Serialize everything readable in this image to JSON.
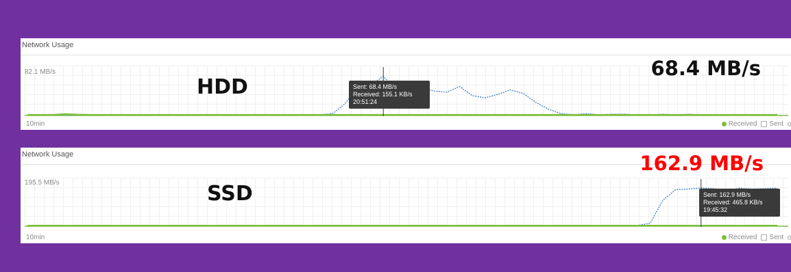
{
  "colors": {
    "background": "#7030a0",
    "received_line": "#3f7fc0",
    "baseline": "#7cbf3a",
    "highlight": "#ff0000",
    "tooltip_bg": "#3a3a3a"
  },
  "panels": [
    {
      "id": "hdd",
      "title": "Network Usage",
      "max_label": "82.1 MB/s",
      "range_label": "10min",
      "big_label": "HDD",
      "speed_label": "68.4 MB/s",
      "speed_color": "#111111",
      "legend": {
        "received": "Received",
        "sent": "Sent",
        "zero": "0"
      },
      "tooltip": {
        "sent": "Sent: 68.4 MB/s",
        "received": "Received: 155.1 KB/s",
        "time": "20:51:24"
      }
    },
    {
      "id": "ssd",
      "title": "Network Usage",
      "max_label": "195.5 MB/s",
      "range_label": "10min",
      "big_label": "SSD",
      "speed_label": "162.9 MB/s",
      "speed_color": "#ff0000",
      "legend": {
        "received": "Received",
        "sent": "Sent",
        "zero": "0"
      },
      "tooltip": {
        "sent": "Sent: 162.9 MB/s",
        "received": "Received: 465.8 KB/s",
        "time": "19:45:32"
      }
    }
  ],
  "chart_data": [
    {
      "type": "line",
      "title": "Network Usage",
      "ylim": [
        0,
        82.1
      ],
      "xlabel": "10min",
      "hover_index": 28,
      "series": [
        {
          "name": "Sent",
          "values": [
            0,
            0,
            0,
            0,
            0,
            0,
            0,
            0,
            0,
            0,
            0,
            0,
            0,
            0,
            0,
            0,
            0,
            0,
            0,
            0,
            0,
            0,
            0,
            0,
            2,
            20,
            48,
            52,
            68,
            45,
            36,
            48,
            42,
            40,
            50,
            34,
            30,
            36,
            44,
            38,
            22,
            10,
            2,
            0,
            2,
            0,
            1,
            1,
            0,
            0,
            1,
            0,
            1,
            0,
            0,
            0,
            0,
            0,
            0,
            0
          ]
        },
        {
          "name": "Received",
          "values": [
            0,
            0,
            0,
            1.5,
            0.5,
            0,
            0,
            0,
            0,
            0,
            0,
            0,
            0,
            0,
            0,
            0,
            0,
            0,
            0,
            0,
            0,
            0,
            0,
            0,
            0,
            0,
            0,
            0,
            0,
            0,
            0,
            0,
            0,
            0,
            0,
            0,
            0,
            0,
            0,
            0,
            0,
            0,
            0,
            0,
            0,
            0,
            0,
            0,
            0,
            0,
            0,
            0,
            0,
            0,
            0,
            0,
            0,
            0,
            0,
            0
          ]
        }
      ]
    },
    {
      "type": "line",
      "title": "Network Usage",
      "ylim": [
        0,
        195.5
      ],
      "xlabel": "10min",
      "hover_index": 53,
      "series": [
        {
          "name": "Sent",
          "values": [
            0,
            0,
            0,
            0,
            0,
            0,
            0,
            0,
            0,
            0,
            0,
            0,
            0,
            0,
            0,
            0,
            0,
            0,
            0,
            0,
            0,
            0,
            0,
            0,
            0,
            0,
            0,
            0,
            0,
            0,
            0,
            0,
            0,
            0,
            0,
            0,
            0,
            0,
            0,
            0,
            0,
            0,
            0,
            0,
            0,
            0,
            0,
            0,
            0,
            10,
            110,
            155,
            158,
            162.9,
            160,
            150,
            162,
            158,
            160,
            162
          ]
        },
        {
          "name": "Received",
          "values": [
            0,
            0,
            0,
            0,
            0,
            0,
            0,
            0,
            0,
            0,
            0,
            0,
            0,
            0,
            0,
            0,
            0,
            0,
            0,
            0,
            0,
            0,
            0,
            0,
            0,
            0,
            0,
            0,
            0,
            0,
            0,
            0,
            0,
            0,
            0,
            0,
            0,
            0,
            0,
            0,
            0,
            0,
            0,
            0,
            0,
            0,
            0,
            0,
            0,
            0,
            0,
            0,
            0,
            0,
            0,
            0,
            0,
            0,
            0,
            0
          ]
        }
      ]
    }
  ]
}
